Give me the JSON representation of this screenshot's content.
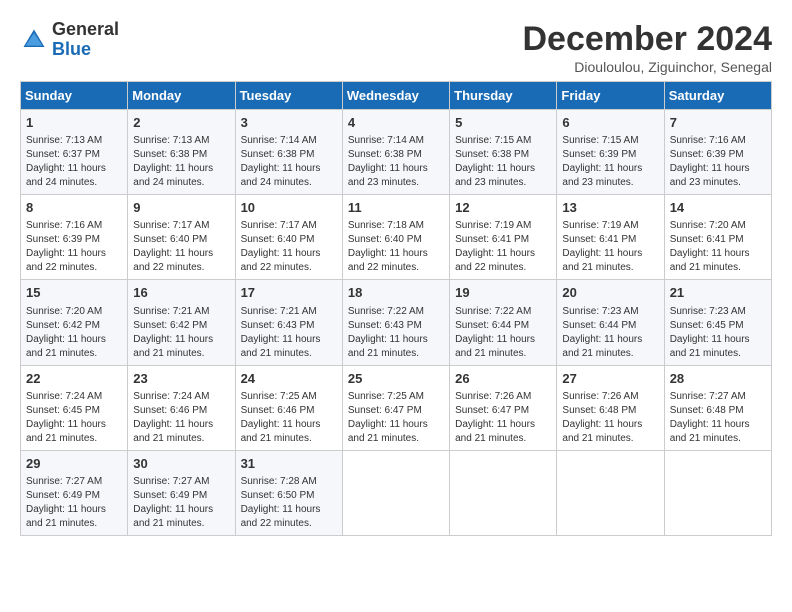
{
  "header": {
    "logo_general": "General",
    "logo_blue": "Blue",
    "month_title": "December 2024",
    "location": "Diouloulou, Ziguinchor, Senegal"
  },
  "days_of_week": [
    "Sunday",
    "Monday",
    "Tuesday",
    "Wednesday",
    "Thursday",
    "Friday",
    "Saturday"
  ],
  "weeks": [
    [
      {
        "day": "1",
        "info": "Sunrise: 7:13 AM\nSunset: 6:37 PM\nDaylight: 11 hours and 24 minutes."
      },
      {
        "day": "2",
        "info": "Sunrise: 7:13 AM\nSunset: 6:38 PM\nDaylight: 11 hours and 24 minutes."
      },
      {
        "day": "3",
        "info": "Sunrise: 7:14 AM\nSunset: 6:38 PM\nDaylight: 11 hours and 24 minutes."
      },
      {
        "day": "4",
        "info": "Sunrise: 7:14 AM\nSunset: 6:38 PM\nDaylight: 11 hours and 23 minutes."
      },
      {
        "day": "5",
        "info": "Sunrise: 7:15 AM\nSunset: 6:38 PM\nDaylight: 11 hours and 23 minutes."
      },
      {
        "day": "6",
        "info": "Sunrise: 7:15 AM\nSunset: 6:39 PM\nDaylight: 11 hours and 23 minutes."
      },
      {
        "day": "7",
        "info": "Sunrise: 7:16 AM\nSunset: 6:39 PM\nDaylight: 11 hours and 23 minutes."
      }
    ],
    [
      {
        "day": "8",
        "info": "Sunrise: 7:16 AM\nSunset: 6:39 PM\nDaylight: 11 hours and 22 minutes."
      },
      {
        "day": "9",
        "info": "Sunrise: 7:17 AM\nSunset: 6:40 PM\nDaylight: 11 hours and 22 minutes."
      },
      {
        "day": "10",
        "info": "Sunrise: 7:17 AM\nSunset: 6:40 PM\nDaylight: 11 hours and 22 minutes."
      },
      {
        "day": "11",
        "info": "Sunrise: 7:18 AM\nSunset: 6:40 PM\nDaylight: 11 hours and 22 minutes."
      },
      {
        "day": "12",
        "info": "Sunrise: 7:19 AM\nSunset: 6:41 PM\nDaylight: 11 hours and 22 minutes."
      },
      {
        "day": "13",
        "info": "Sunrise: 7:19 AM\nSunset: 6:41 PM\nDaylight: 11 hours and 21 minutes."
      },
      {
        "day": "14",
        "info": "Sunrise: 7:20 AM\nSunset: 6:41 PM\nDaylight: 11 hours and 21 minutes."
      }
    ],
    [
      {
        "day": "15",
        "info": "Sunrise: 7:20 AM\nSunset: 6:42 PM\nDaylight: 11 hours and 21 minutes."
      },
      {
        "day": "16",
        "info": "Sunrise: 7:21 AM\nSunset: 6:42 PM\nDaylight: 11 hours and 21 minutes."
      },
      {
        "day": "17",
        "info": "Sunrise: 7:21 AM\nSunset: 6:43 PM\nDaylight: 11 hours and 21 minutes."
      },
      {
        "day": "18",
        "info": "Sunrise: 7:22 AM\nSunset: 6:43 PM\nDaylight: 11 hours and 21 minutes."
      },
      {
        "day": "19",
        "info": "Sunrise: 7:22 AM\nSunset: 6:44 PM\nDaylight: 11 hours and 21 minutes."
      },
      {
        "day": "20",
        "info": "Sunrise: 7:23 AM\nSunset: 6:44 PM\nDaylight: 11 hours and 21 minutes."
      },
      {
        "day": "21",
        "info": "Sunrise: 7:23 AM\nSunset: 6:45 PM\nDaylight: 11 hours and 21 minutes."
      }
    ],
    [
      {
        "day": "22",
        "info": "Sunrise: 7:24 AM\nSunset: 6:45 PM\nDaylight: 11 hours and 21 minutes."
      },
      {
        "day": "23",
        "info": "Sunrise: 7:24 AM\nSunset: 6:46 PM\nDaylight: 11 hours and 21 minutes."
      },
      {
        "day": "24",
        "info": "Sunrise: 7:25 AM\nSunset: 6:46 PM\nDaylight: 11 hours and 21 minutes."
      },
      {
        "day": "25",
        "info": "Sunrise: 7:25 AM\nSunset: 6:47 PM\nDaylight: 11 hours and 21 minutes."
      },
      {
        "day": "26",
        "info": "Sunrise: 7:26 AM\nSunset: 6:47 PM\nDaylight: 11 hours and 21 minutes."
      },
      {
        "day": "27",
        "info": "Sunrise: 7:26 AM\nSunset: 6:48 PM\nDaylight: 11 hours and 21 minutes."
      },
      {
        "day": "28",
        "info": "Sunrise: 7:27 AM\nSunset: 6:48 PM\nDaylight: 11 hours and 21 minutes."
      }
    ],
    [
      {
        "day": "29",
        "info": "Sunrise: 7:27 AM\nSunset: 6:49 PM\nDaylight: 11 hours and 21 minutes."
      },
      {
        "day": "30",
        "info": "Sunrise: 7:27 AM\nSunset: 6:49 PM\nDaylight: 11 hours and 21 minutes."
      },
      {
        "day": "31",
        "info": "Sunrise: 7:28 AM\nSunset: 6:50 PM\nDaylight: 11 hours and 22 minutes."
      },
      {
        "day": "",
        "info": ""
      },
      {
        "day": "",
        "info": ""
      },
      {
        "day": "",
        "info": ""
      },
      {
        "day": "",
        "info": ""
      }
    ]
  ]
}
